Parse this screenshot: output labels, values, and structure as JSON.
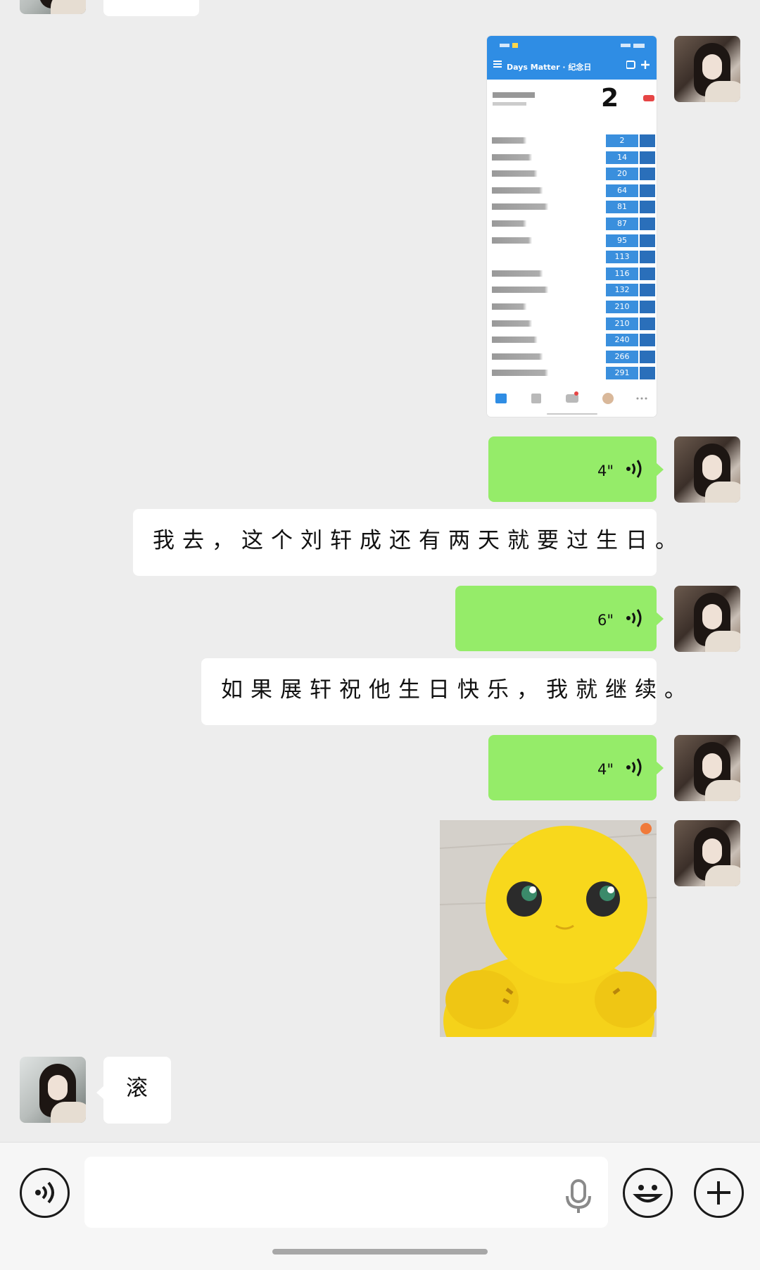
{
  "messages": [
    {
      "id": "img-screenshot",
      "side": "right",
      "type": "image",
      "image_name": "days-matter-screenshot"
    },
    {
      "id": "voice1",
      "side": "right",
      "type": "voice",
      "duration": "4\""
    },
    {
      "id": "text1",
      "side": "right",
      "type": "text",
      "text": "我去，这个刘轩成还有两天就要过生日。"
    },
    {
      "id": "voice2",
      "side": "right",
      "type": "voice",
      "duration": "6\""
    },
    {
      "id": "text2",
      "side": "right",
      "type": "text",
      "text": "如果展轩祝他生日快乐，我就继续。"
    },
    {
      "id": "voice3",
      "side": "right",
      "type": "voice",
      "duration": "4\""
    },
    {
      "id": "img-sticker",
      "side": "right",
      "type": "image",
      "image_name": "yellow-dino-sticker"
    },
    {
      "id": "text3",
      "side": "left",
      "type": "text",
      "text": "滚"
    }
  ],
  "screenshot": {
    "app_title": "Days Matter · 纪念日",
    "big_number": "2",
    "day_counts": [
      "2",
      "14",
      "20",
      "64",
      "81",
      "87",
      "95",
      "113",
      "116",
      "132",
      "210",
      "210",
      "240",
      "266",
      "291"
    ]
  },
  "input": {
    "placeholder": ""
  },
  "colors": {
    "sent_bubble": "#95ec69",
    "received_bubble": "#ffffff",
    "background": "#ededed"
  },
  "icons": [
    "voice-icon",
    "mic-icon",
    "emoji-icon",
    "plus-icon"
  ]
}
